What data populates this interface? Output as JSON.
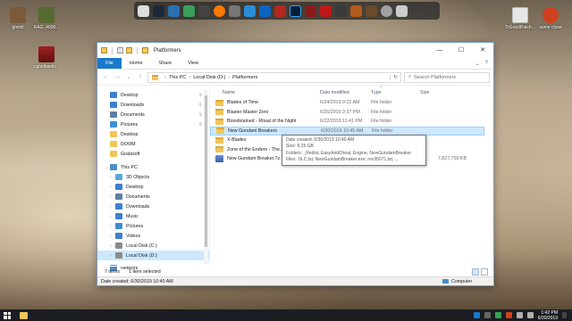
{
  "desktop": {
    "icons": [
      {
        "label": "gtxmil",
        "color": "#7b5a3a"
      },
      {
        "label": "RAG_4000...",
        "color": "#556b2f"
      },
      {
        "label": "cgtxdlasdn...",
        "color": "#a02020"
      },
      {
        "label": "TrGoodPatch...",
        "color": "#c9c9c9"
      },
      {
        "label": "some close",
        "color": "#d04020"
      }
    ]
  },
  "dock": {
    "items": [
      "steam-icon",
      "app-icon",
      "media-icon",
      "music-icon",
      "browser-icon",
      "lock-icon",
      "edge-icon",
      "outlook-icon",
      "filezilla-icon",
      "photoshop-icon",
      "game-icon",
      "game-icon",
      "game-icon",
      "game-icon",
      "game-icon",
      "game-icon",
      "settings-icon",
      "trash-icon"
    ]
  },
  "window": {
    "title": "Platformers",
    "ribbon": {
      "file": "File",
      "tabs": [
        "Home",
        "Share",
        "View"
      ]
    },
    "address": {
      "crumbs": [
        "This PC",
        "Local Disk (D:)",
        "Platformers"
      ]
    },
    "search": {
      "placeholder": "Search Platformers"
    },
    "nav": [
      {
        "label": "Desktop",
        "type": "pinned",
        "color": "#3d7fd1"
      },
      {
        "label": "Downloads",
        "type": "pinned",
        "color": "#3d7fd1"
      },
      {
        "label": "Documents",
        "type": "pinned",
        "color": "#5c7fa6"
      },
      {
        "label": "Pictures",
        "type": "pinned",
        "color": "#3d8fd1"
      },
      {
        "label": "Desktop",
        "type": "folder",
        "color": "#f2c55c"
      },
      {
        "label": "DOOM",
        "type": "folder",
        "color": "#f2c55c"
      },
      {
        "label": "Grabisoft",
        "type": "folder",
        "color": "#f2c55c"
      },
      {
        "label": "This PC",
        "type": "pc",
        "color": "#4d8ec9"
      },
      {
        "label": "3D Objects",
        "type": "sub",
        "color": "#5aa7e0"
      },
      {
        "label": "Desktop",
        "type": "sub",
        "color": "#3d7fd1"
      },
      {
        "label": "Documents",
        "type": "sub",
        "color": "#5c7fa6"
      },
      {
        "label": "Downloads",
        "type": "sub",
        "color": "#3d7fd1"
      },
      {
        "label": "Music",
        "type": "sub",
        "color": "#3d7fd1"
      },
      {
        "label": "Pictures",
        "type": "sub",
        "color": "#3d8fd1"
      },
      {
        "label": "Videos",
        "type": "sub",
        "color": "#3d7fd1"
      },
      {
        "label": "Local Disk (C:)",
        "type": "sub",
        "color": "#8a8a8a"
      },
      {
        "label": "Local Disk (D:)",
        "type": "sub-sel",
        "color": "#8a8a8a"
      },
      {
        "label": "Network",
        "type": "net",
        "color": "#4d8ec9"
      }
    ],
    "columns": [
      "Name",
      "Date modified",
      "Type",
      "Size"
    ],
    "files": [
      {
        "name": "Blades of Time",
        "date": "6/24/2019 9:22 AM",
        "type": "File folder",
        "size": "",
        "kind": "folder"
      },
      {
        "name": "Blaster Master Zero",
        "date": "6/26/2019 3:37 PM",
        "type": "File folder",
        "size": "",
        "kind": "folder"
      },
      {
        "name": "Bloodstained - Ritual of the Night",
        "date": "6/22/2019 11:41 PM",
        "type": "File folder",
        "size": "",
        "kind": "folder"
      },
      {
        "name": "New Gundam Breakers",
        "date": "6/30/2019 10:45 AM",
        "type": "File folder",
        "size": "",
        "kind": "folder",
        "selected": true
      },
      {
        "name": "X-Blades",
        "date": "",
        "type": "File folder",
        "size": "",
        "kind": "folder"
      },
      {
        "name": "Zone of the Enders - The...",
        "date": "",
        "type": "File folder",
        "size": "",
        "kind": "folder"
      },
      {
        "name": "New Gundam Breaker.7z",
        "date": "",
        "type": "",
        "size": "7,827,703 KB",
        "kind": "archive"
      }
    ],
    "tooltip": {
      "line1": "Date created: 6/30/2019 10:40 AM",
      "line2": "Size: 8.25 GB",
      "line3": "Folders: _Redist, EasyAntiCheat, Engine, NewGundamBreaker",
      "line4": "Files: DLC.txt, NewGundamBreaker.exe, rev35071.txt, ..."
    },
    "status": {
      "items": "7 items",
      "selected": "1 item selected"
    },
    "details": {
      "left": "Date created: 6/30/2019 10:40 AM",
      "right": "Computer"
    }
  },
  "taskbar": {
    "time": "1:42 PM",
    "date": "6/30/2019"
  }
}
